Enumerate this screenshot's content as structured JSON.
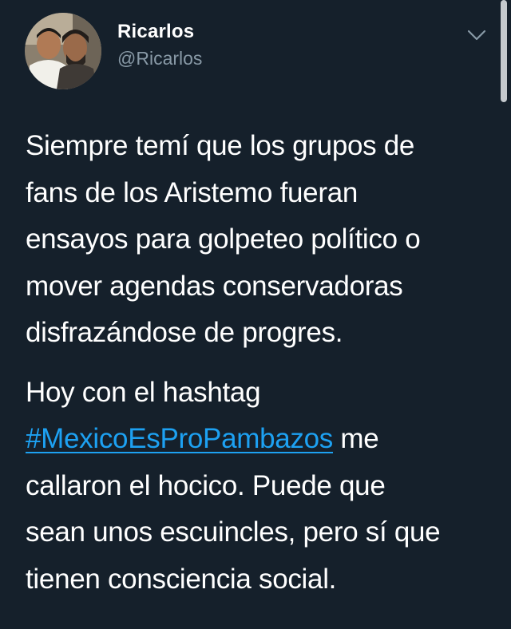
{
  "author": {
    "display_name": "Ricarlos",
    "handle": "@Ricarlos"
  },
  "icons": {
    "menu": "chevron-down-icon",
    "avatar": "avatar"
  },
  "colors": {
    "background": "#15202b",
    "text": "#ffffff",
    "secondary_text": "#8899a6",
    "link": "#1da1f2"
  },
  "tweet": {
    "paragraph1": {
      "line1": "Siempre temí que los grupos de",
      "line2": "fans de los Aristemo fueran",
      "line3": "ensayos para golpeteo político o",
      "line4": "mover agendas conservadoras",
      "line5": "disfrazándose de progres."
    },
    "paragraph2": {
      "line1": "Hoy con el hashtag",
      "hashtag": "#MexicoEsProPambazos",
      "line2_rest": " me",
      "line3": "callaron el hocico. Puede que",
      "line4": "sean unos escuincles, pero sí que",
      "line5": "tienen consciencia social."
    }
  }
}
